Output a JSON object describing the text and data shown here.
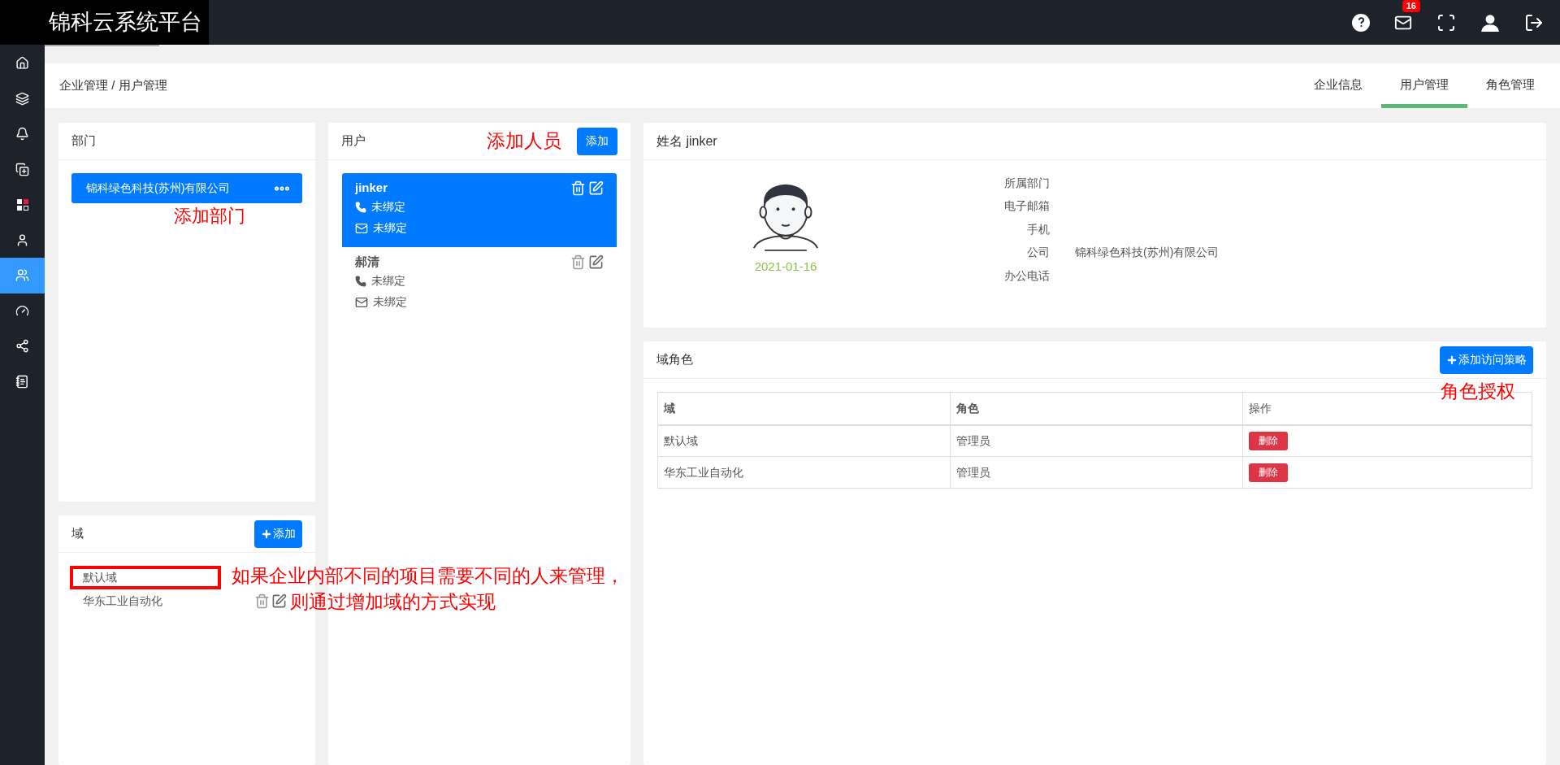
{
  "header": {
    "logo": "锦科云系统平台",
    "mail_badge": "16"
  },
  "sidebar": {
    "items": [
      {
        "selected": false
      },
      {
        "selected": false
      },
      {
        "selected": false
      },
      {
        "selected": false
      },
      {
        "selected": false
      },
      {
        "selected": false
      },
      {
        "selected": true
      },
      {
        "selected": false
      },
      {
        "selected": false
      },
      {
        "selected": false
      }
    ]
  },
  "breadcrumb": "企业管理 / 用户管理",
  "tabs": [
    {
      "label": "企业信息",
      "selected": false
    },
    {
      "label": "用户管理",
      "selected": true
    },
    {
      "label": "角色管理",
      "selected": false
    }
  ],
  "departments": {
    "title": "部门",
    "items": [
      {
        "name": "锦科绿色科技(苏州)有限公司",
        "selected": true
      }
    ],
    "annotation": "添加部门"
  },
  "domains": {
    "title": "域",
    "add_button": "添加",
    "items": [
      {
        "name": "默认域",
        "boxed": true,
        "show_actions": false
      },
      {
        "name": "华东工业自动化",
        "boxed": false,
        "show_actions": true
      }
    ],
    "annotation": [
      "如果企业内部不同的项目需要不同的人来管理，",
      "则通过增加域的方式实现"
    ]
  },
  "users": {
    "title": "用户",
    "add_button": "添加",
    "annotation": "添加人员",
    "items": [
      {
        "name": "jinker",
        "phone": "未绑定",
        "email": "未绑定",
        "selected": true
      },
      {
        "name": "郝清",
        "phone": "未绑定",
        "email": "未绑定",
        "selected": false
      }
    ]
  },
  "profile": {
    "title": "姓名 jinker",
    "date": "2021-01-16",
    "fields": [
      {
        "label": "所属部门"
      },
      {
        "label": "电子邮箱"
      },
      {
        "label": "手机"
      },
      {
        "label": "公司",
        "value": "锦科绿色科技(苏州)有限公司"
      },
      {
        "label": "办公电话"
      }
    ]
  },
  "domain_roles": {
    "title": "域角色",
    "add_button": "添加访问策略",
    "annotation": "角色授权",
    "columns": [
      "域",
      "角色",
      "操作"
    ],
    "rows": [
      {
        "domain": "默认域",
        "role": "管理员",
        "action": "删除"
      },
      {
        "domain": "华东工业自动化",
        "role": "管理员",
        "action": "删除"
      }
    ]
  }
}
